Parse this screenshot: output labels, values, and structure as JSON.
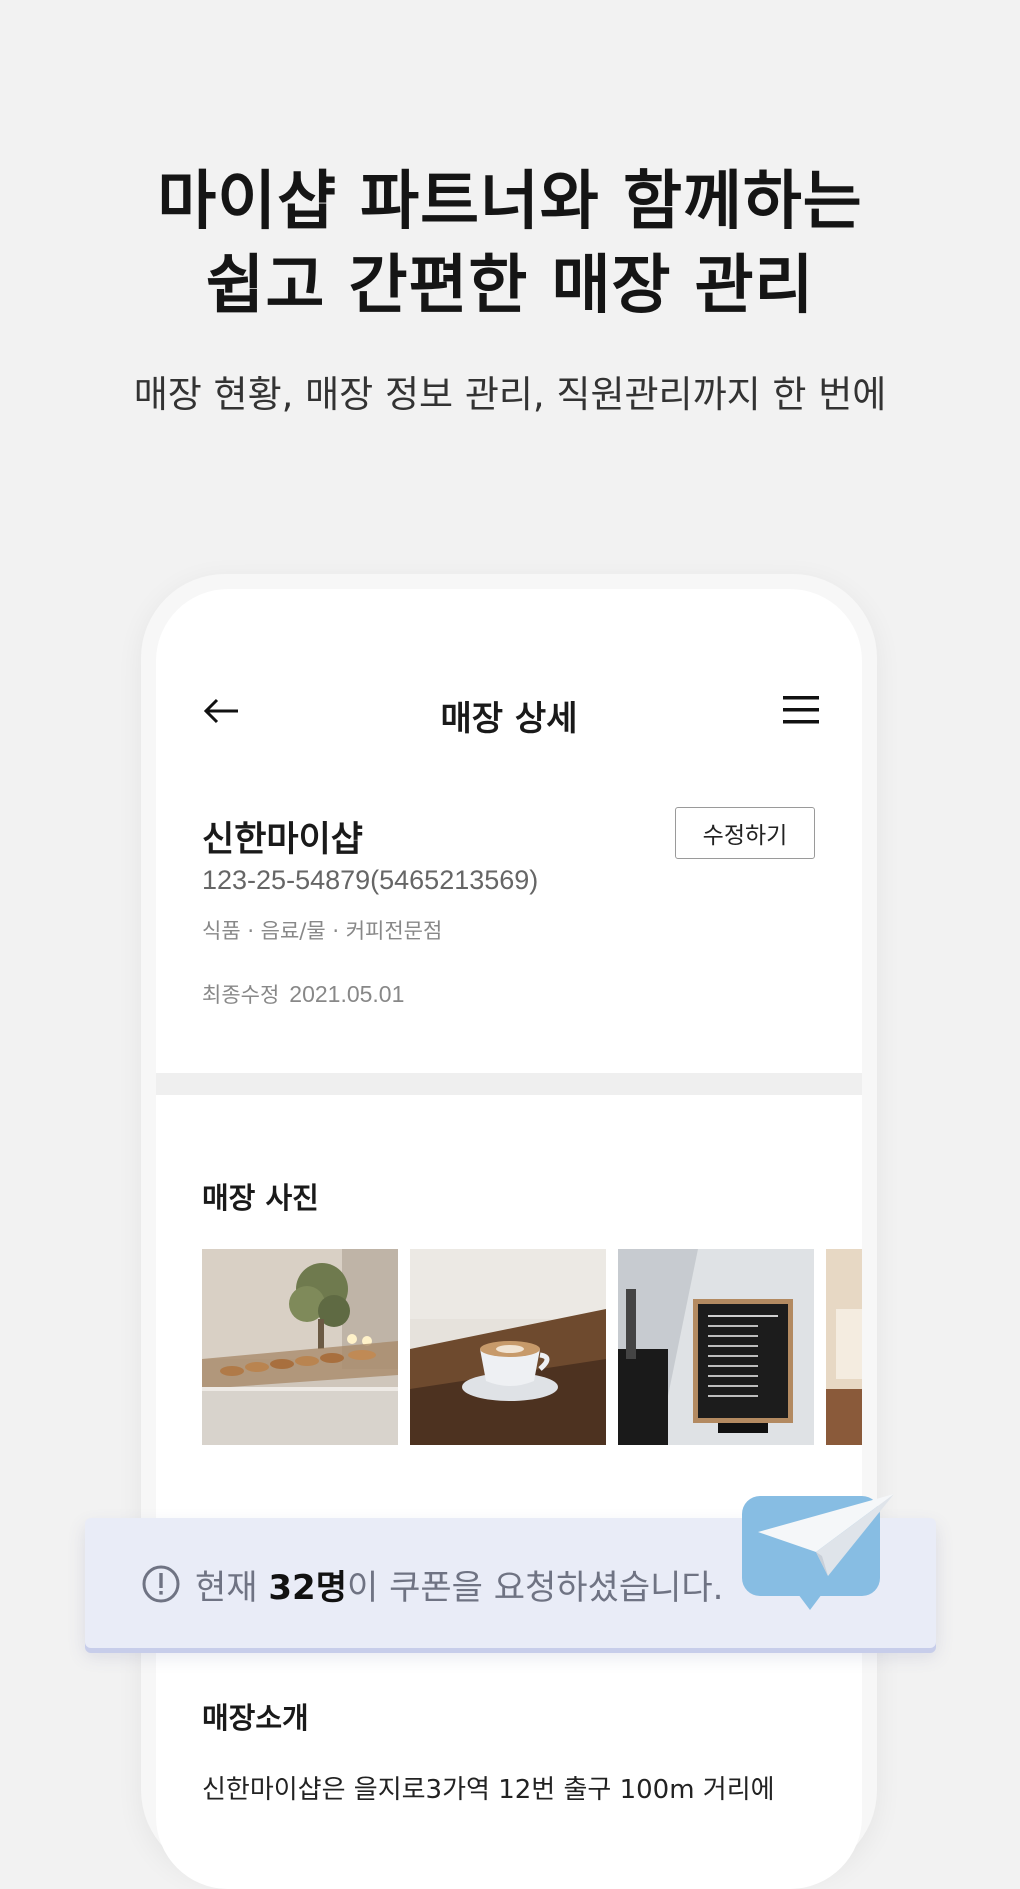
{
  "hero": {
    "title_line1": "마이샵 파트너와 함께하는",
    "title_line2": "쉽고 간편한 매장 관리",
    "subtitle": "매장 현황, 매장 정보 관리, 직원관리까지 한 번에"
  },
  "header": {
    "title": "매장 상세",
    "back_icon": "back-arrow-icon",
    "menu_icon": "hamburger-menu-icon"
  },
  "store": {
    "name": "신한마이샵",
    "edit_label": "수정하기",
    "biz_number": "123-25-54879(5465213569)",
    "category": "식품 · 음료/물 · 커피전문점",
    "last_modified_label": "최종수정",
    "last_modified_date": "2021.05.01"
  },
  "photos": {
    "title": "매장 사진",
    "items": [
      "bakery-display",
      "latte-cup",
      "menu-board",
      "cafe-interior"
    ]
  },
  "intro": {
    "title": "매장소개",
    "text": "신한마이샵은 을지로3가역 12번 출구 100m 거리에"
  },
  "banner": {
    "prefix": "현재 ",
    "count": "32명",
    "suffix": "이 쿠폰을 요청하셨습니다.",
    "icon": "alert-circle-icon",
    "colors": {
      "background": "#e9ecf7",
      "bubble": "#87bde3"
    }
  }
}
